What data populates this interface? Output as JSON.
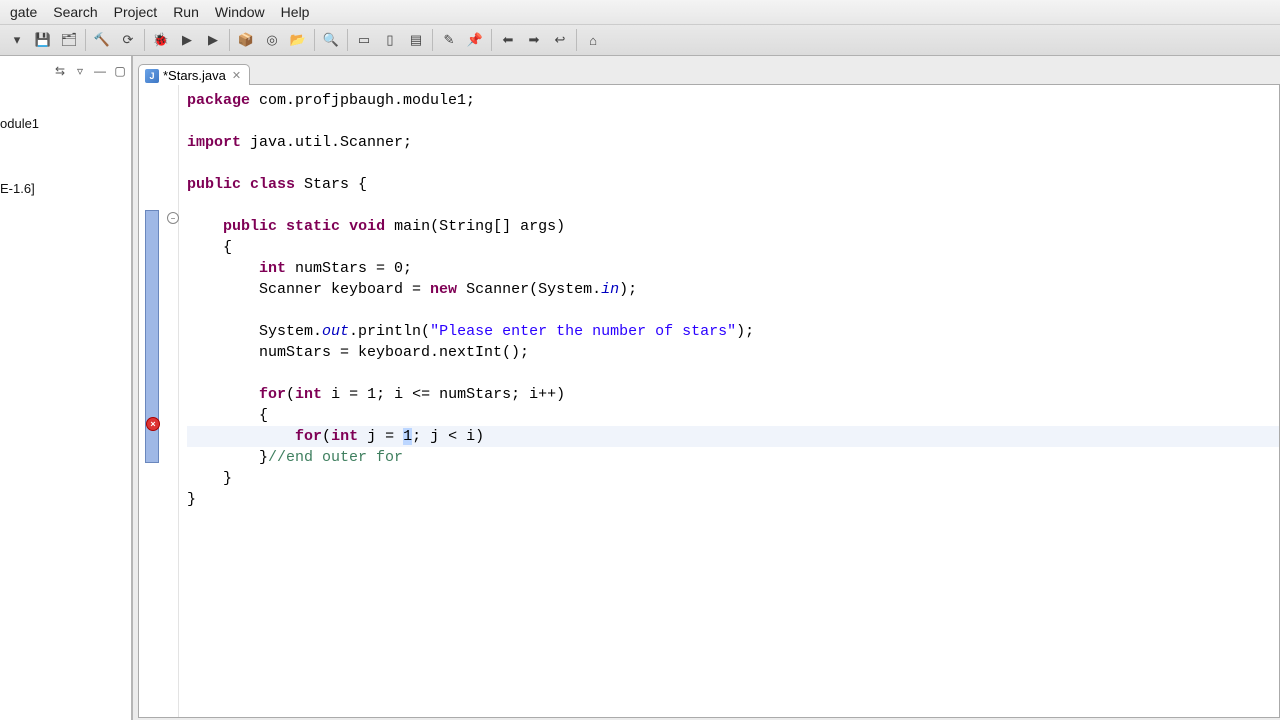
{
  "menu": {
    "items": [
      "gate",
      "Search",
      "Project",
      "Run",
      "Window",
      "Help"
    ]
  },
  "sidebar": {
    "item1": "odule1",
    "item2": "E-1.6]"
  },
  "tab": {
    "label": "*Stars.java"
  },
  "code": {
    "l1a": "package",
    "l1b": " com.profjpbaugh.module1;",
    "l3a": "import",
    "l3b": " java.util.Scanner;",
    "l5a": "public",
    "l5b": " ",
    "l5c": "class",
    "l5d": " Stars {",
    "l7a": "    ",
    "l7b": "public",
    "l7c": " ",
    "l7d": "static",
    "l7e": " ",
    "l7f": "void",
    "l7g": " main(String[] args)",
    "l8": "    {",
    "l9a": "        ",
    "l9b": "int",
    "l9c": " numStars = 0;",
    "l10a": "        Scanner keyboard = ",
    "l10b": "new",
    "l10c": " Scanner(System.",
    "l10d": "in",
    "l10e": ");",
    "l12a": "        System.",
    "l12b": "out",
    "l12c": ".println(",
    "l12d": "\"Please enter the number of stars\"",
    "l12e": ");",
    "l13": "        numStars = keyboard.nextInt();",
    "l15a": "        ",
    "l15b": "for",
    "l15c": "(",
    "l15d": "int",
    "l15e": " i = 1; i <= numStars; i++)",
    "l16": "        {",
    "l17a": "            ",
    "l17b": "for",
    "l17c": "(",
    "l17d": "int",
    "l17e": " j = ",
    "l17sel": "1",
    "l17f": "; j < i)",
    "l18a": "        }",
    "l18b": "//end outer for",
    "l19": "    }",
    "l20": "}"
  }
}
